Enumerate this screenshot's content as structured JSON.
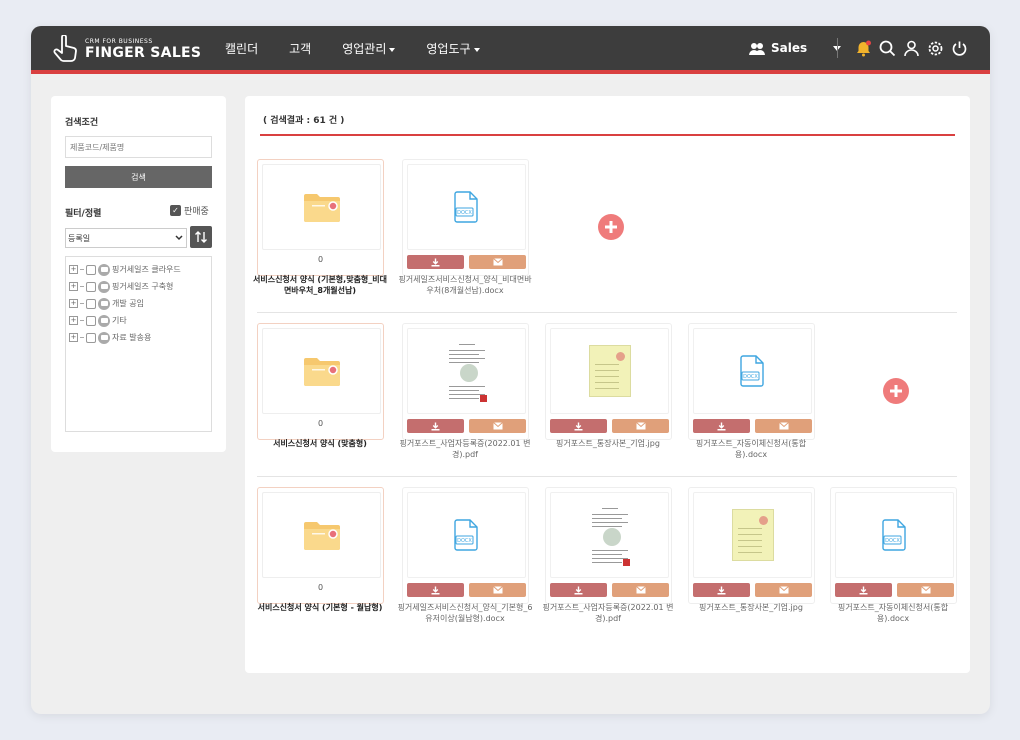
{
  "header": {
    "logo_sub": "CRM FOR BUSINESS",
    "logo_main": "FINGER SALES",
    "nav": [
      {
        "label": "캘린더",
        "dropdown": false
      },
      {
        "label": "고객",
        "dropdown": false
      },
      {
        "label": "영업관리",
        "dropdown": true
      },
      {
        "label": "영업도구",
        "dropdown": true
      }
    ],
    "user_label": "Sales",
    "accent": "#d94040"
  },
  "sidebar": {
    "search_title": "검색조건",
    "search_placeholder": "제품코드/제품명",
    "search_button": "검색",
    "filter_title": "필터/정렬",
    "on_sale_label": "판매중",
    "sort_value": "등록일",
    "tree": [
      "핑거세일즈 클라우드",
      "핑거세일즈 구축형",
      "개발 공임",
      "기타",
      "자료 발송용"
    ]
  },
  "main": {
    "result_text": "( 검색결과 : 61 건 )",
    "rows": [
      {
        "folder": {
          "count": "0",
          "name": "서비스신청서 양식 (기본형,맞춤형_비대면바우처_8개월선납)"
        },
        "files": [
          {
            "type": "docx",
            "name": "핑거세일즈서비스신청서_양식_비대면바우처(8개월선납).docx"
          }
        ]
      },
      {
        "folder": {
          "count": "0",
          "name": "서비스신청서 양식 (맞춤형)"
        },
        "files": [
          {
            "type": "pdf",
            "name": "핑거포스트_사업자등록증(2022.01 변경).pdf"
          },
          {
            "type": "jpg",
            "name": "핑거포스트_통장사본_기업.jpg"
          },
          {
            "type": "docx",
            "name": "핑거포스트_자동이체신청서(통합용).docx"
          }
        ]
      },
      {
        "folder": {
          "count": "0",
          "name": "서비스신청서 양식 (기본형 - 월납형)"
        },
        "files": [
          {
            "type": "docx",
            "name": "핑거세일즈서비스신청서_양식_기본형_6유저이상(월납형).docx"
          },
          {
            "type": "pdf",
            "name": "핑거포스트_사업자등록증(2022.01 변경).pdf"
          },
          {
            "type": "jpg",
            "name": "핑거포스트_통장사본_기업.jpg"
          },
          {
            "type": "docx",
            "name": "핑거포스트_자동이체신청서(통합용).docx"
          }
        ]
      }
    ],
    "docx_label": "DOCX"
  }
}
